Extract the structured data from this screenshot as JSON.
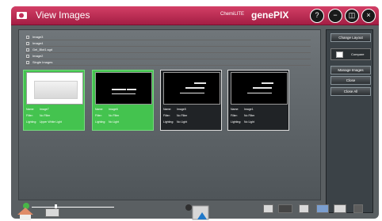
{
  "window": {
    "title": "View Images",
    "brand_small": "ChemiLITE",
    "brand": "genePIX"
  },
  "image_list": [
    "Image3",
    "Image4",
    "Gel_Blot1.sgd",
    "Image2",
    "Single Images"
  ],
  "thumbnails": [
    {
      "name": "Image7",
      "filter": "No Filter",
      "lighting": "Upper White Light",
      "selected": true
    },
    {
      "name": "Image6",
      "filter": "No Filter",
      "lighting": "No Light",
      "selected": true
    },
    {
      "name": "Image5",
      "filter": "No Filter",
      "lighting": "No Light",
      "selected": false
    },
    {
      "name": "Image1",
      "filter": "No Filter",
      "lighting": "No Light",
      "selected": false
    }
  ],
  "labels": {
    "name": "Name:",
    "filter": "Filter:",
    "lighting": "Lighting:"
  },
  "side_buttons": {
    "change_layout": "Change Layout",
    "compare": "Compare",
    "manage_images": "Manage Images",
    "close": "Close",
    "close_all": "Close All"
  },
  "colors": {
    "title_bar": "#c2305a",
    "selected": "#44c34f"
  }
}
